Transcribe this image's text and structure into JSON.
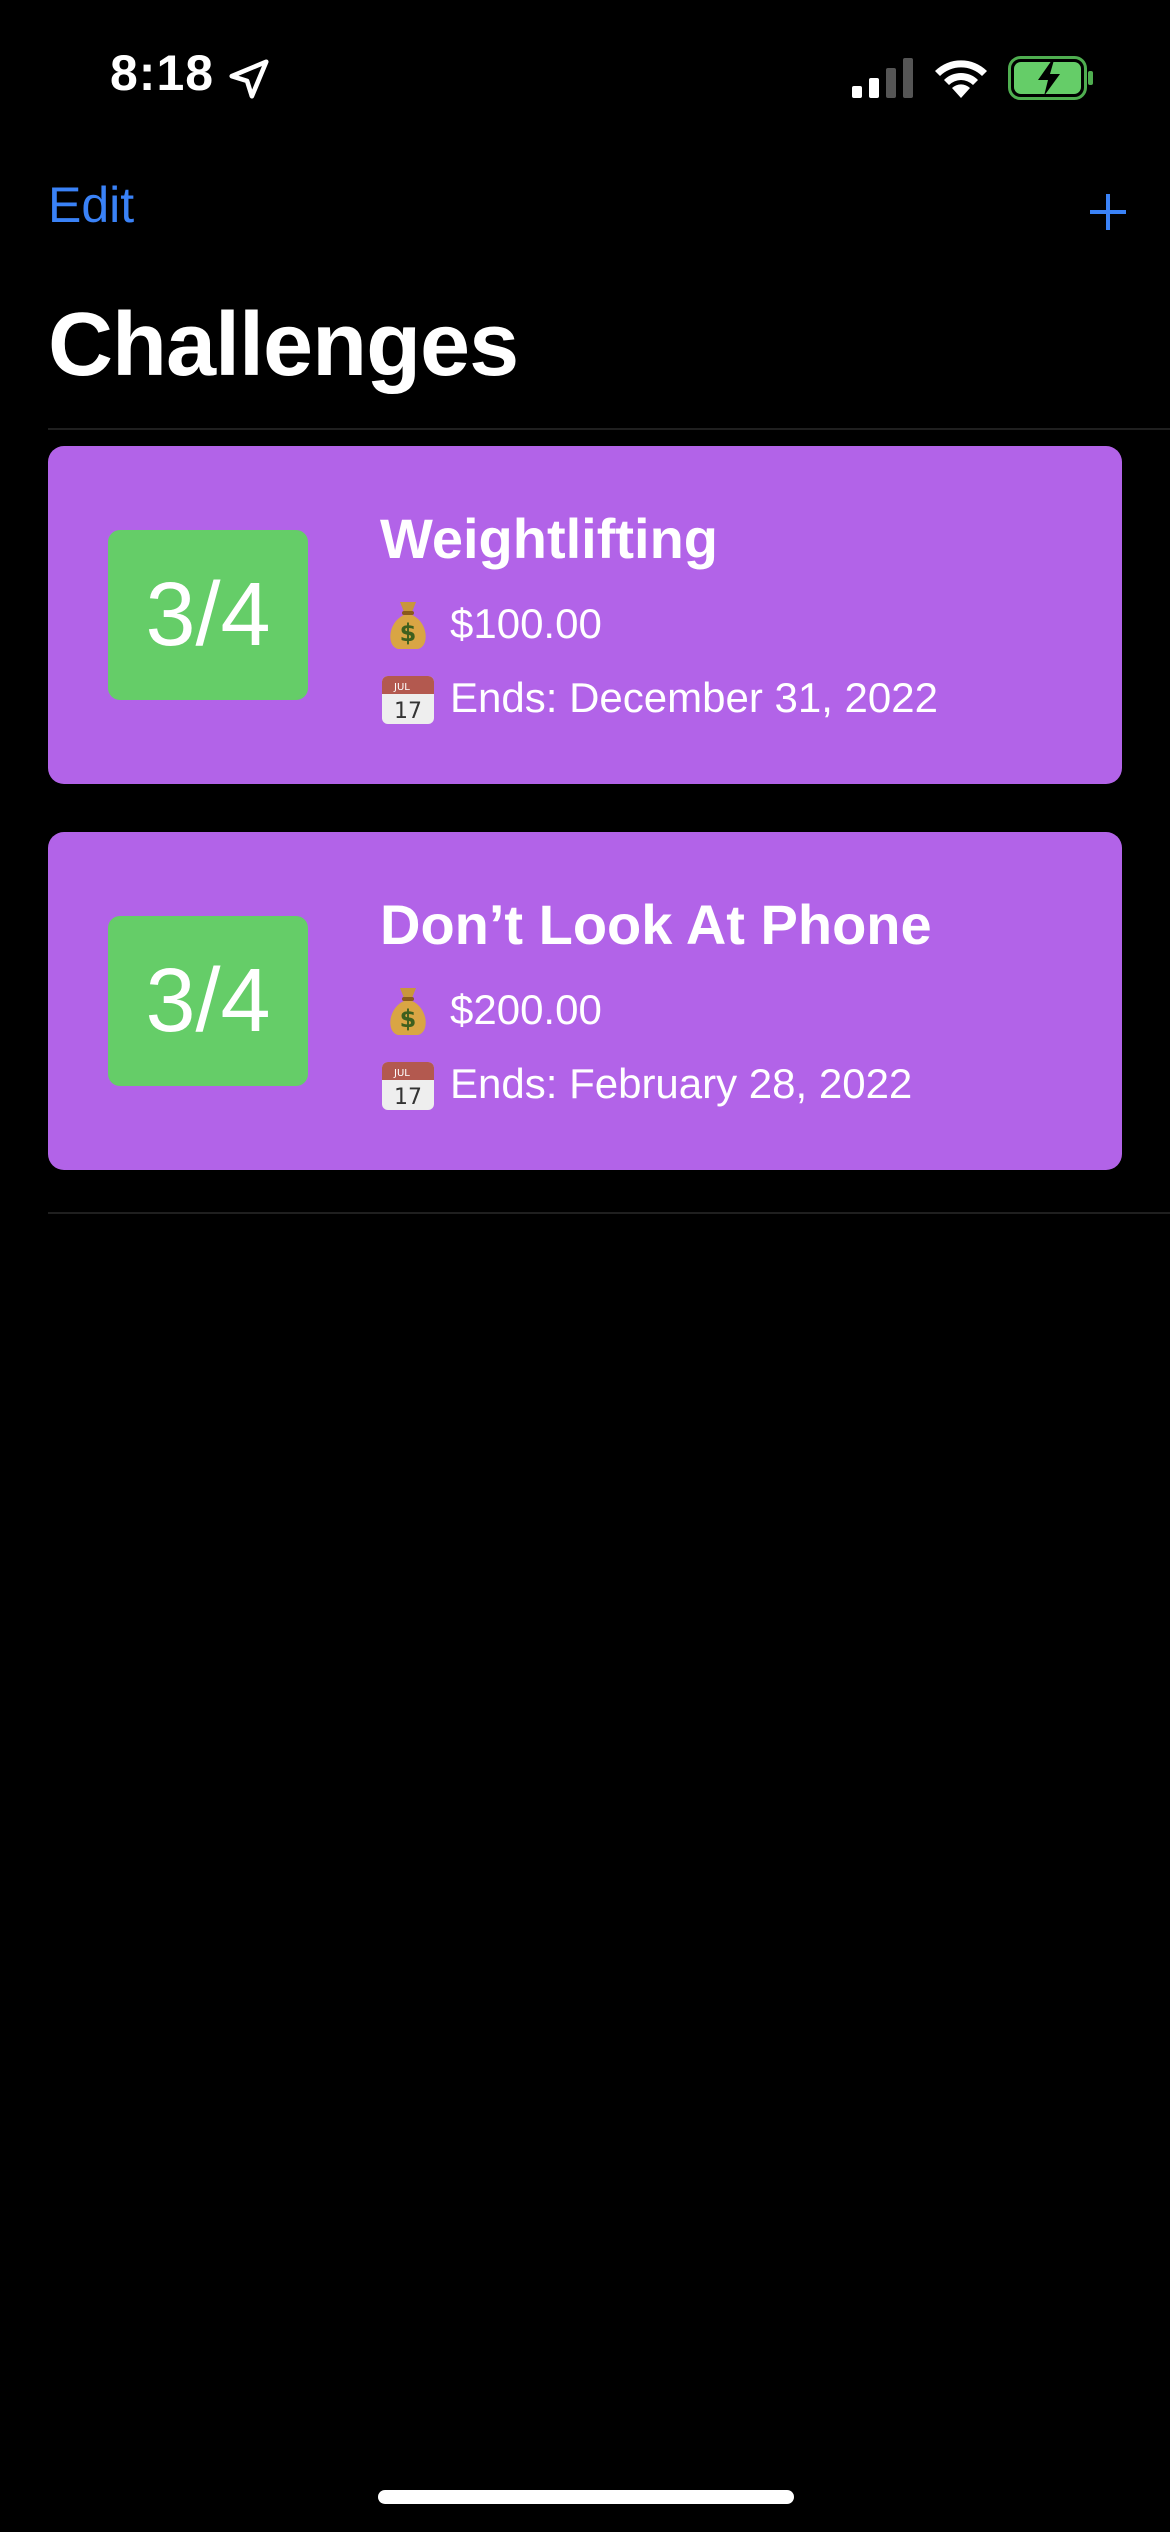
{
  "status_bar": {
    "time": "8:18"
  },
  "nav": {
    "edit_label": "Edit",
    "add_label": "+",
    "title": "Challenges"
  },
  "colors": {
    "background": "#000000",
    "accent": "#3a82f7",
    "card": "#b263e8",
    "progress": "#65cd68"
  },
  "challenges": [
    {
      "progress": "3/4",
      "name": "Weightlifting",
      "amount_icon": "money-bag-icon",
      "amount": "$100.00",
      "date_icon": "calendar-icon",
      "ends": "Ends: December 31, 2022"
    },
    {
      "progress": "3/4",
      "name": "Don’t Look At Phone",
      "amount_icon": "money-bag-icon",
      "amount": "$200.00",
      "date_icon": "calendar-icon",
      "ends": "Ends: February 28, 2022"
    }
  ]
}
